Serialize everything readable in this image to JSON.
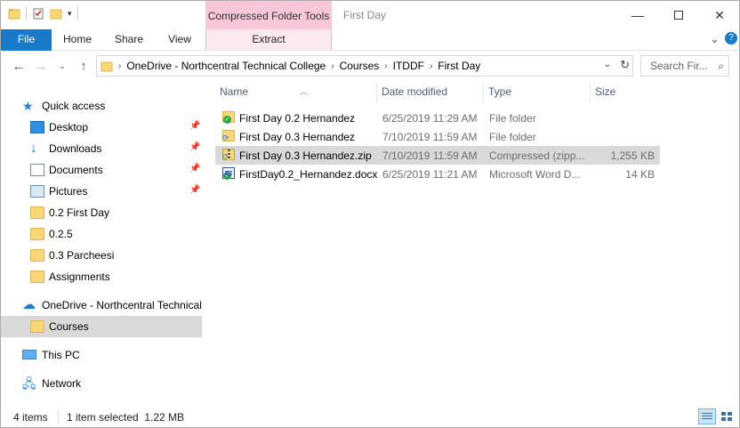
{
  "window": {
    "title": "First Day",
    "context_tab_group": "Compressed Folder Tools"
  },
  "ribbon": {
    "tabs": [
      "File",
      "Home",
      "Share",
      "View",
      "Extract"
    ]
  },
  "address": {
    "crumbs": [
      "OneDrive - Northcentral Technical College",
      "Courses",
      "ITDDF",
      "First Day"
    ]
  },
  "search": {
    "placeholder": "Search Fir..."
  },
  "navpane": {
    "items": [
      {
        "label": "Quick access",
        "icon": "star-icon"
      },
      {
        "label": "Desktop",
        "icon": "desktop-icon",
        "pinned": true
      },
      {
        "label": "Downloads",
        "icon": "download-icon",
        "pinned": true
      },
      {
        "label": "Documents",
        "icon": "documents-icon",
        "pinned": true
      },
      {
        "label": "Pictures",
        "icon": "pictures-icon",
        "pinned": true
      },
      {
        "label": "0.2 First Day",
        "icon": "folder-icon"
      },
      {
        "label": "0.2.5",
        "icon": "folder-icon"
      },
      {
        "label": "0.3 Parcheesi",
        "icon": "folder-icon"
      },
      {
        "label": "Assignments",
        "icon": "folder-icon"
      },
      {
        "label": "OneDrive - Northcentral Technical",
        "icon": "cloud-icon"
      },
      {
        "label": "Courses",
        "icon": "folder-icon",
        "selected": true
      },
      {
        "label": "This PC",
        "icon": "computer-icon"
      },
      {
        "label": "Network",
        "icon": "network-icon"
      }
    ]
  },
  "filelist": {
    "columns": [
      "Name",
      "Date modified",
      "Type",
      "Size"
    ],
    "rows": [
      {
        "name": "First Day 0.2 Hernandez",
        "date": "6/25/2019 11:29 AM",
        "type": "File folder",
        "size": "",
        "icon": "folder-icon",
        "status": "synced"
      },
      {
        "name": "First Day 0.3 Hernandez",
        "date": "7/10/2019 11:59 AM",
        "type": "File folder",
        "size": "",
        "icon": "folder-icon",
        "status": "syncing"
      },
      {
        "name": "First Day 0.3 Hernandez.zip",
        "date": "7/10/2019 11:59 AM",
        "type": "Compressed (zipp...",
        "size": "1,255 KB",
        "icon": "zip-icon",
        "status": "syncing",
        "selected": true
      },
      {
        "name": "FirstDay0.2_Hernandez.docx",
        "date": "6/25/2019 11:21 AM",
        "type": "Microsoft Word D...",
        "size": "14 KB",
        "icon": "docx-icon",
        "status": "synced"
      }
    ]
  },
  "status": {
    "item_count": "4 items",
    "selection": "1 item selected  1.22 MB"
  },
  "colors": {
    "file_tab": "#1979ca",
    "context_tab": "#f7c6d9",
    "selection": "#d9d9d9",
    "folder": "#f8d775"
  }
}
